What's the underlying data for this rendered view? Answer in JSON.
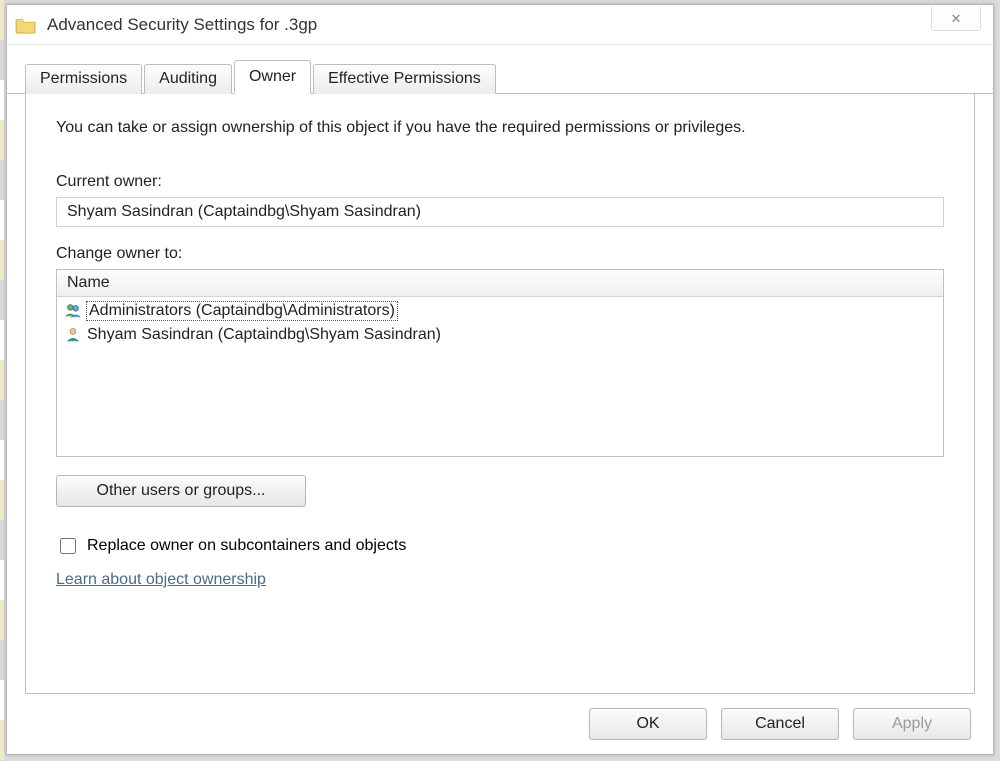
{
  "window": {
    "title": "Advanced Security Settings for .3gp",
    "close_glyph": "✕"
  },
  "tabs": {
    "permissions": "Permissions",
    "auditing": "Auditing",
    "owner": "Owner",
    "effective": "Effective Permissions"
  },
  "owner_tab": {
    "description": "You can take or assign ownership of this object if you have the required permissions or privileges.",
    "current_owner_label": "Current owner:",
    "current_owner_value": "Shyam Sasindran (Captaindbg\\Shyam Sasindran)",
    "change_owner_label": "Change owner to:",
    "list_header": "Name",
    "owners": [
      {
        "name": "Administrators (Captaindbg\\Administrators)",
        "icon": "group"
      },
      {
        "name": "Shyam Sasindran (Captaindbg\\Shyam Sasindran)",
        "icon": "user"
      }
    ],
    "other_users_btn": "Other users or groups...",
    "replace_checkbox_label": "Replace owner on subcontainers and objects",
    "learn_link": "Learn about object ownership"
  },
  "footer": {
    "ok": "OK",
    "cancel": "Cancel",
    "apply": "Apply"
  }
}
